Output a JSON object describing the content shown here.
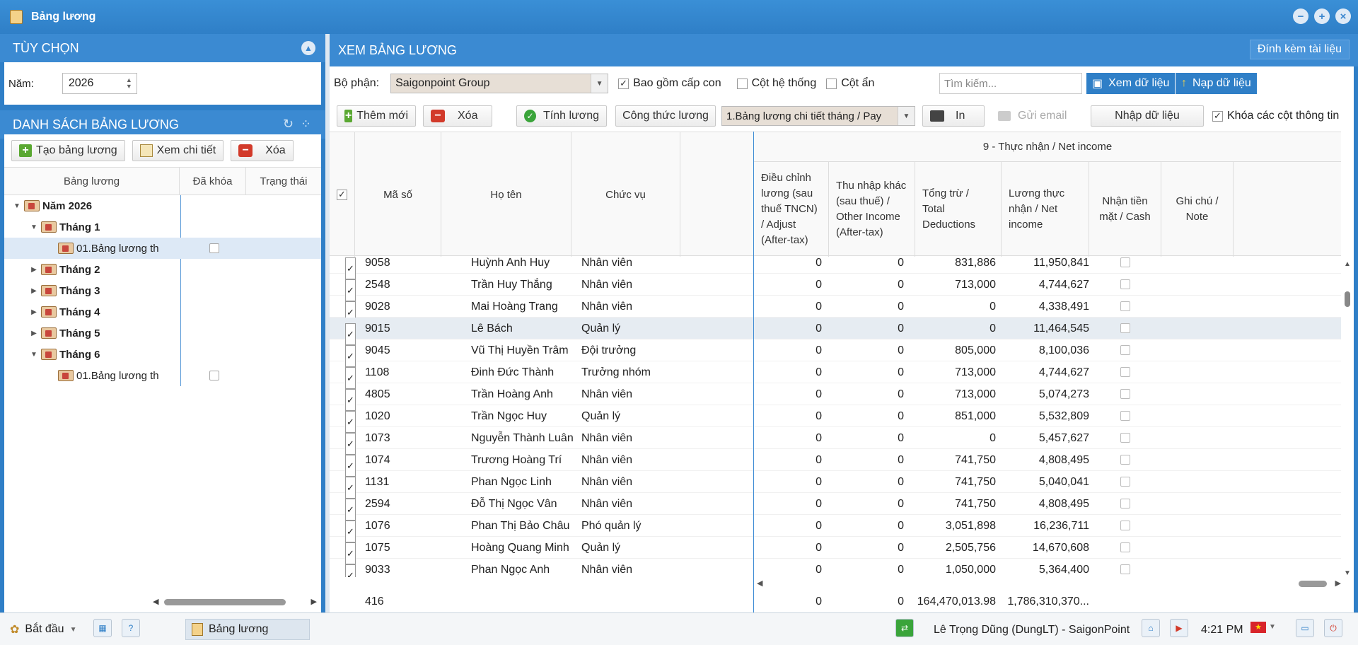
{
  "window": {
    "title": "Bảng lương"
  },
  "left": {
    "options_title": "TÙY CHỌN",
    "year_label": "Năm:",
    "year_value": "2026",
    "list_title": "DANH SÁCH BẢNG LƯƠNG",
    "buttons": {
      "create": "Tạo bảng lương",
      "view": "Xem chi tiết",
      "delete": "Xóa"
    },
    "columns": [
      "Bảng lương",
      "Đã khóa",
      "Trạng thái"
    ],
    "tree": [
      {
        "label": "Năm 2026",
        "level": 0,
        "expanded": true,
        "bold": true
      },
      {
        "label": "Tháng 1",
        "level": 1,
        "expanded": true,
        "bold": true
      },
      {
        "label": "01.Bảng lương th",
        "level": 2,
        "leaf": true,
        "selected": true
      },
      {
        "label": "Tháng 2",
        "level": 1,
        "expanded": false,
        "bold": true
      },
      {
        "label": "Tháng 3",
        "level": 1,
        "expanded": false,
        "bold": true
      },
      {
        "label": "Tháng 4",
        "level": 1,
        "expanded": false,
        "bold": true
      },
      {
        "label": "Tháng 5",
        "level": 1,
        "expanded": false,
        "bold": true
      },
      {
        "label": "Tháng 6",
        "level": 1,
        "expanded": true,
        "bold": true
      },
      {
        "label": "01.Bảng lương th",
        "level": 2,
        "leaf": true
      }
    ]
  },
  "right": {
    "title": "XEM BẢNG LƯƠNG",
    "attach": "Đính kèm tài liệu",
    "dept_label": "Bộ phận:",
    "dept_value": "Saigonpoint Group",
    "include_children": "Bao gồm cấp con",
    "system_cols": "Cột hệ thống",
    "hidden_cols": "Cột ẩn",
    "search_placeholder": "Tìm kiếm...",
    "view_data": "Xem dữ liệu",
    "load_data": "Nạp dữ liệu",
    "add": "Thêm mới",
    "delete": "Xóa",
    "calc": "Tính lương",
    "formula": "Công thức lương",
    "template": "1.Bảng lương chi tiết tháng / Pay",
    "print": "In",
    "email": "Gửi email",
    "import": "Nhập dữ liệu",
    "lock_cols": "Khóa các cột thông tin"
  },
  "grid": {
    "group_title": "9 - Thực nhận / Net income",
    "headers": {
      "code": "Mã số",
      "name": "Họ tên",
      "position": "Chức vụ",
      "adjust": "Điều chỉnh lương (sau thuế TNCN) / Adjust (After-tax)",
      "other": "Thu nhập khác (sau thuế) / Other Income (After-tax)",
      "deductions": "Tổng trừ / Total Deductions",
      "net": "Lương thực nhận / Net income",
      "cash": "Nhận tiền mặt / Cash",
      "note": "Ghi chú / Note"
    },
    "rows": [
      [
        "9058",
        "Huỳnh Anh Huy",
        "Nhân viên",
        "0",
        "0",
        "831,886",
        "11,950,841"
      ],
      [
        "2548",
        "Trần Huy Thắng",
        "Nhân viên",
        "0",
        "0",
        "713,000",
        "4,744,627"
      ],
      [
        "9028",
        "Mai Hoàng Trang",
        "Nhân viên",
        "0",
        "0",
        "0",
        "4,338,491"
      ],
      [
        "9015",
        "Lê Bách",
        "Quản lý",
        "0",
        "0",
        "0",
        "11,464,545"
      ],
      [
        "9045",
        "Vũ Thị Huyền Trâm",
        "Đội trưởng",
        "0",
        "0",
        "805,000",
        "8,100,036"
      ],
      [
        "1108",
        "Đinh Đức Thành",
        "Trưởng nhóm",
        "0",
        "0",
        "713,000",
        "4,744,627"
      ],
      [
        "4805",
        "Trần Hoàng Anh",
        "Nhân viên",
        "0",
        "0",
        "713,000",
        "5,074,273"
      ],
      [
        "1020",
        "Trần Ngọc Huy",
        "Quản lý",
        "0",
        "0",
        "851,000",
        "5,532,809"
      ],
      [
        "1073",
        "Nguyễn Thành Luân",
        "Nhân viên",
        "0",
        "0",
        "0",
        "5,457,627"
      ],
      [
        "1074",
        "Trương Hoàng Trí",
        "Nhân viên",
        "0",
        "0",
        "741,750",
        "4,808,495"
      ],
      [
        "1131",
        "Phan Ngọc Linh",
        "Nhân viên",
        "0",
        "0",
        "741,750",
        "5,040,041"
      ],
      [
        "2594",
        "Đỗ Thị Ngọc Vân",
        "Nhân viên",
        "0",
        "0",
        "741,750",
        "4,808,495"
      ],
      [
        "1076",
        "Phan Thị Bảo Châu",
        "Phó quản lý",
        "0",
        "0",
        "3,051,898",
        "16,236,711"
      ],
      [
        "1075",
        "Hoàng Quang Minh",
        "Quản lý",
        "0",
        "0",
        "2,505,756",
        "14,670,608"
      ],
      [
        "9033",
        "Phan Ngọc Anh",
        "Nhân viên",
        "0",
        "0",
        "1,050,000",
        "5,364,400"
      ]
    ],
    "selected_row": 3,
    "footer": {
      "count": "416",
      "adjust": "0",
      "other": "0",
      "deductions": "164,470,013.98",
      "net": "1,786,310,370..."
    }
  },
  "taskbar": {
    "start": "Bắt đầu",
    "task": "Bảng lương",
    "user": "Lê Trọng Dũng (DungLT) - SaigonPoint",
    "time": "4:21 PM"
  }
}
